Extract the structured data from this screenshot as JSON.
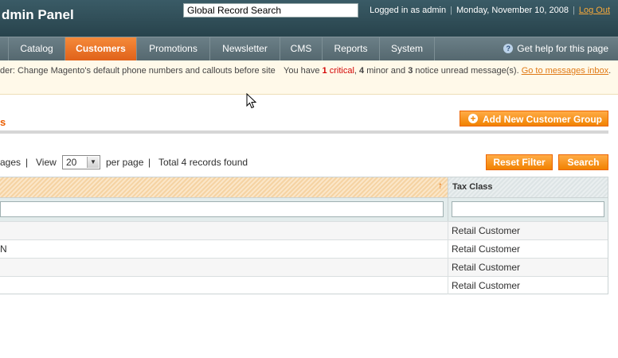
{
  "header": {
    "logo_text": "dmin Panel",
    "search_value": "Global Record Search",
    "logged_in": "Logged in as admin",
    "date": "Monday, November 10, 2008",
    "logout": "Log Out"
  },
  "nav": {
    "items": [
      "Catalog",
      "Customers",
      "Promotions",
      "Newsletter",
      "CMS",
      "Reports",
      "System"
    ],
    "active": "Customers",
    "help": "Get help for this page"
  },
  "notice": {
    "left_text": "der: Change Magento's default phone numbers and callouts before site",
    "you_have": "You have",
    "critical_count": "1",
    "critical_word": "critical",
    "minor_count": "4",
    "minor_word": "minor and",
    "notice_count": "3",
    "notice_tail": "notice unread message(s).",
    "inbox_link": "Go to messages inbox",
    "period": "."
  },
  "page": {
    "title": "s",
    "add_button": "Add New Customer Group"
  },
  "pager": {
    "pages_tail": "ages",
    "sep1": "|",
    "view": "View",
    "per_page_value": "20",
    "per_page": "per page",
    "sep2": "|",
    "records": "Total 4 records found",
    "reset_filter": "Reset Filter",
    "search": "Search"
  },
  "grid": {
    "columns": {
      "group": "",
      "tax_class": "Tax Class"
    },
    "rows": [
      {
        "group": "",
        "tax_class": "Retail Customer"
      },
      {
        "group": "N",
        "tax_class": "Retail Customer"
      },
      {
        "group": "",
        "tax_class": "Retail Customer"
      },
      {
        "group": "",
        "tax_class": "Retail Customer"
      }
    ]
  },
  "icons": {
    "help": "help-icon",
    "plus": "plus-circle-icon",
    "sort": "sort-arrow-icon",
    "cursor": "mouse-pointer-icon"
  },
  "colors": {
    "accent": "#e96c1f",
    "header_bg": "#2c4a54",
    "critical": "#d40707"
  }
}
